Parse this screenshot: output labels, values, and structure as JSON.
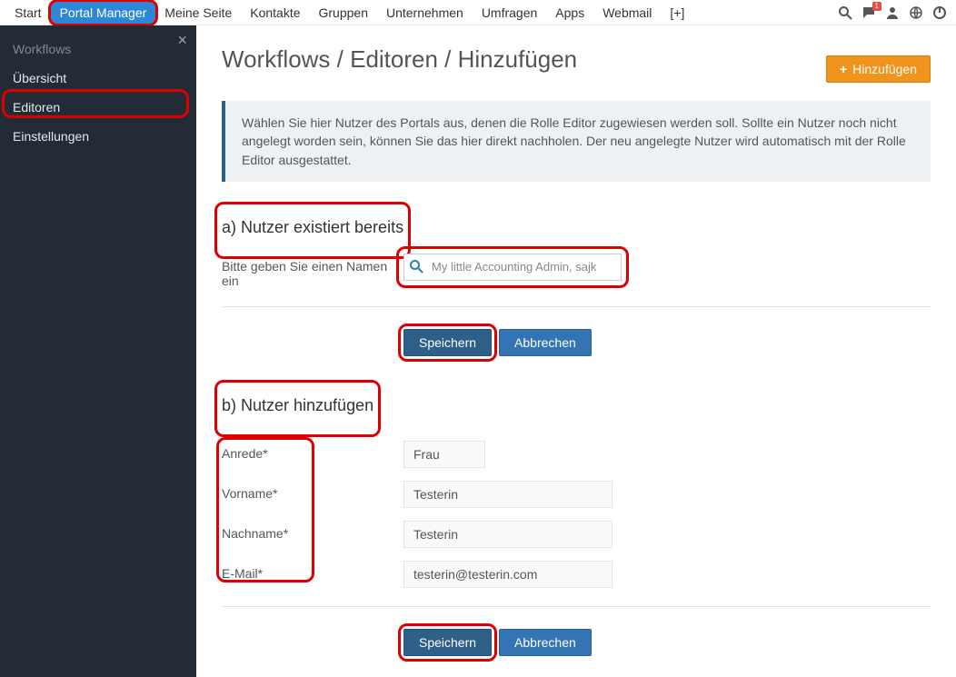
{
  "topnav": {
    "items": [
      "Start",
      "Portal Manager",
      "Meine Seite",
      "Kontakte",
      "Gruppen",
      "Unternehmen",
      "Umfragen",
      "Apps",
      "Webmail",
      "[+]"
    ],
    "active_index": 1,
    "chat_badge": "1"
  },
  "sidebar": {
    "section": "Workflows",
    "items": [
      "Übersicht",
      "Editoren",
      "Einstellungen"
    ],
    "active_index": 1
  },
  "breadcrumb": "Workflows / Editoren / Hinzufügen",
  "add_button": "Hinzufügen",
  "info_text": "Wählen Sie hier Nutzer des Portals aus, denen die Rolle Editor zugewiesen werden soll. Sollte ein Nutzer noch nicht angelegt worden sein, können Sie das hier direkt nachholen. Der neu angelegte Nutzer wird automatisch mit der Rolle Editor ausgestattet.",
  "section_a": {
    "head": "a) Nutzer existiert bereits",
    "label": "Bitte geben Sie einen Namen ein",
    "search_value": "My little Accounting Admin, sajk",
    "save": "Speichern",
    "cancel": "Abbrechen"
  },
  "section_b": {
    "head": "b) Nutzer hinzufügen",
    "anrede_label": "Anrede*",
    "vorname_label": "Vorname*",
    "nachname_label": "Nachname*",
    "email_label": "E-Mail*",
    "anrede_value": "Frau",
    "vorname_value": "Testerin",
    "nachname_value": "Testerin",
    "email_value": "testerin@testerin.com",
    "save": "Speichern",
    "cancel": "Abbrechen"
  }
}
